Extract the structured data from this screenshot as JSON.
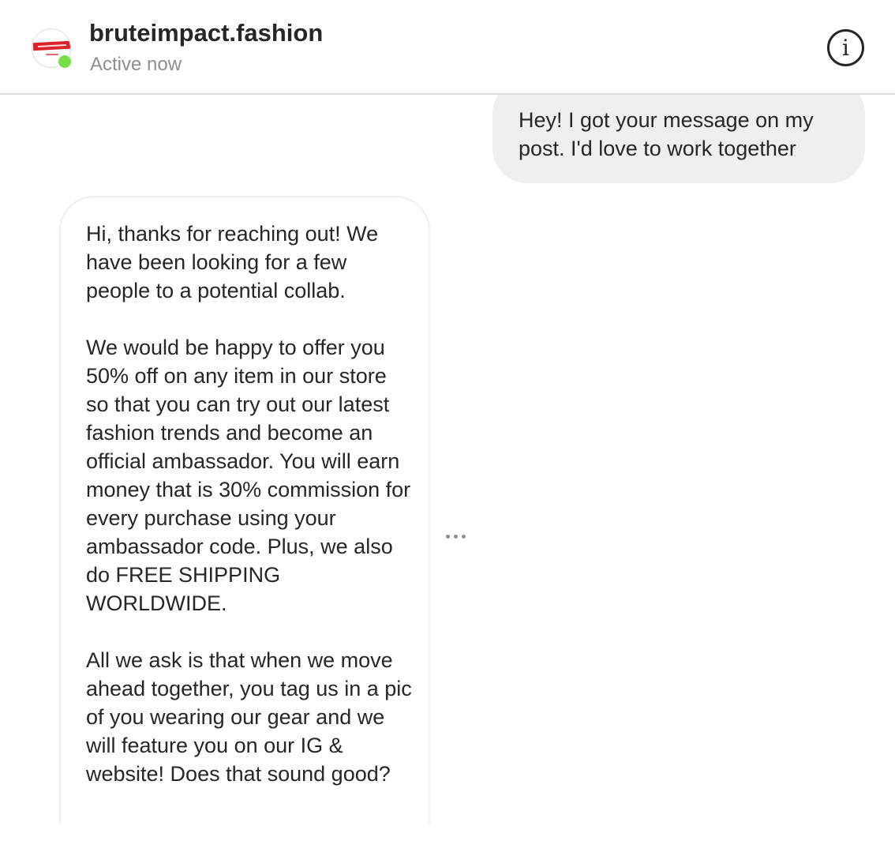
{
  "header": {
    "username": "bruteimpact.fashion",
    "status": "Active now",
    "status_color": "#78de45",
    "avatar_icon": "brand-logo-avatar",
    "info_icon": "info-circle-icon"
  },
  "messages": [
    {
      "direction": "outgoing",
      "paragraphs": [
        "Hey! I got your message on my post. I'd love to work together"
      ]
    },
    {
      "direction": "incoming",
      "paragraphs": [
        "Hi, thanks for reaching out! We have been looking for a few people to a potential collab.",
        "We would be happy to offer you 50% off on any item in our store so that you can try out our latest fashion trends and become an official ambassador. You will earn money that is 30% commission for every purchase using your ambassador code. Plus, we also do FREE SHIPPING WORLDWIDE.",
        "All we ask is that when we move ahead together, you tag us in a pic of you wearing our gear and we will feature you on our IG & website! Does that sound good?"
      ]
    }
  ],
  "message_options_icon": "more-horizontal-icon"
}
